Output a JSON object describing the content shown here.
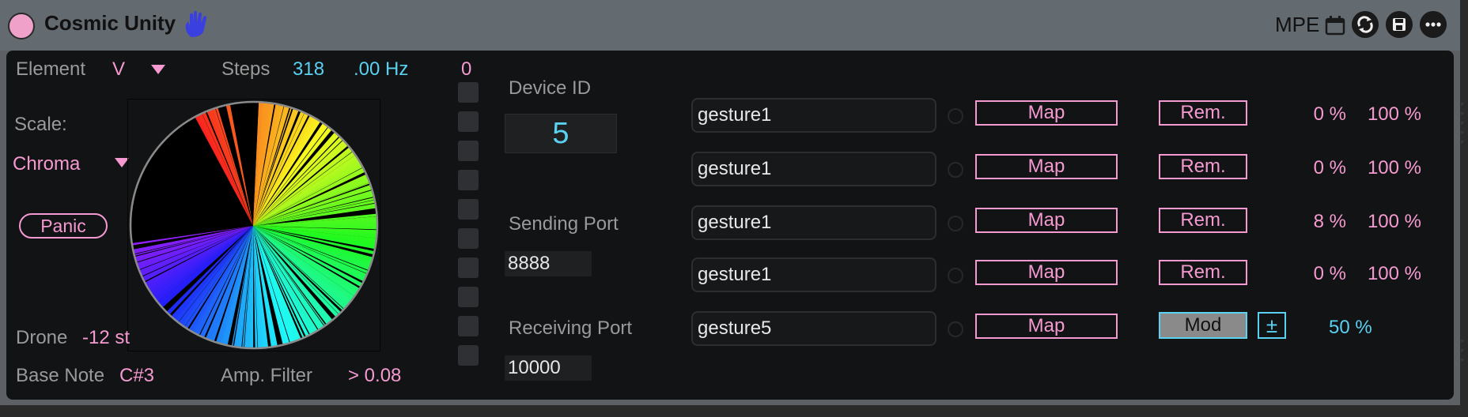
{
  "header": {
    "title": "Cosmic Unity",
    "mode": "MPE"
  },
  "left": {
    "element_label": "Element",
    "element_value": "V",
    "steps_label": "Steps",
    "steps_value": "318",
    "freq_value": ".00 Hz",
    "counter_value": "0",
    "scale_label": "Scale:",
    "scale_value": "Chroma",
    "panic_label": "Panic",
    "drone_label": "Drone",
    "drone_value": "-12 st",
    "base_note_label": "Base Note",
    "base_note_value": "C#3",
    "amp_filter_label": "Amp. Filter",
    "amp_filter_value": "> 0.08"
  },
  "network": {
    "device_id_label": "Device ID",
    "device_id_value": "5",
    "sending_port_label": "Sending Port",
    "sending_port_value": "8888",
    "receiving_port_label": "Receiving Port",
    "receiving_port_value": "10000"
  },
  "gestures": [
    {
      "name": "gesture1",
      "map": "Map",
      "action": "Rem.",
      "min": "0 %",
      "max": "100 %"
    },
    {
      "name": "gesture1",
      "map": "Map",
      "action": "Rem.",
      "min": "0 %",
      "max": "100 %"
    },
    {
      "name": "gesture1",
      "map": "Map",
      "action": "Rem.",
      "min": "8 %",
      "max": "100 %"
    },
    {
      "name": "gesture1",
      "map": "Map",
      "action": "Rem.",
      "min": "0 %",
      "max": "100 %"
    }
  ],
  "mod_row": {
    "name": "gesture5",
    "map": "Map",
    "mod_label": "Mod",
    "plusminus": "±",
    "amount": "50 %"
  },
  "colors": {
    "accent_pink": "#f59ad0",
    "accent_cyan": "#5bd1f2",
    "panel_bg": "#121315",
    "title_bar": "#636a70"
  },
  "icons": [
    "power-icon",
    "hand-icon",
    "calendar-icon",
    "sync-icon",
    "save-icon",
    "more-icon"
  ]
}
